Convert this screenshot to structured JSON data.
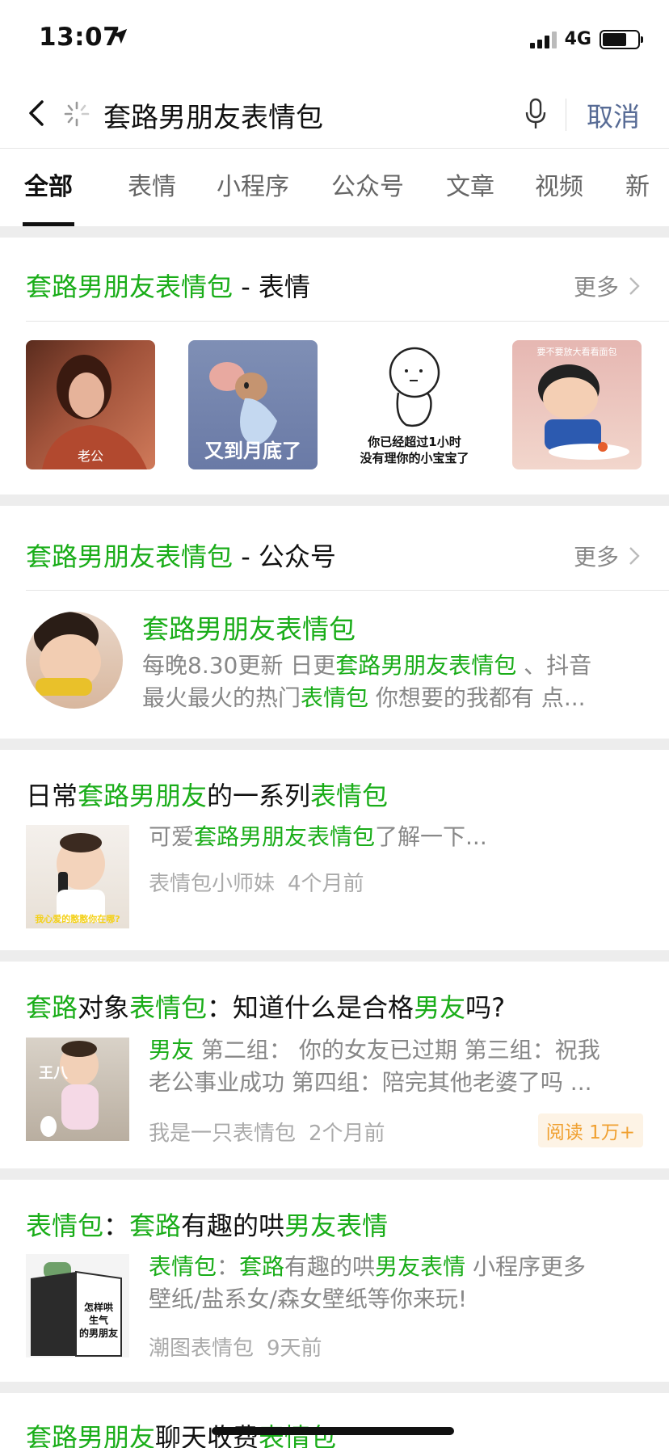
{
  "status": {
    "time": "13:07",
    "network": "4G"
  },
  "search": {
    "query": "套路男朋友表情包",
    "cancel": "取消"
  },
  "tabs": [
    "全部",
    "表情",
    "小程序",
    "公众号",
    "文章",
    "视频",
    "新"
  ],
  "stickers_section": {
    "keyword": "套路男朋友表情包",
    "sep": " - 表情",
    "more": "更多",
    "items": [
      {
        "caption": "老公"
      },
      {
        "caption": "又到月底了"
      },
      {
        "caption_line1": "你已经超过1小时",
        "caption_line2": "没有理你的小宝宝了"
      },
      {
        "caption": "要不要放大看看面包"
      }
    ]
  },
  "account_section": {
    "keyword": "套路男朋友表情包",
    "sep": " - 公众号",
    "more": "更多",
    "name": "套路男朋友表情包",
    "desc_a": "每晚8.30更新 日更",
    "desc_b": "套路男朋友表情包",
    "desc_c": " 、抖音",
    "desc_d": "最火最火的热门",
    "desc_e": "表情包",
    "desc_f": " 你想要的我都有 点..."
  },
  "articles": [
    {
      "t1": "日常",
      "t2": "套路男朋友",
      "t3": "的一系列",
      "t4": "表情包",
      "d1": "可爱",
      "d2": "套路男朋友表情包",
      "d3": "了解一下...",
      "source": "表情包小师妹",
      "time": "4个月前",
      "thumb_caption": "我心爱的憨憨你在哪?"
    },
    {
      "t1": "套路",
      "t2": "对象",
      "t3": "表情包",
      "t4": "：知道什么是合格",
      "t5": "男友",
      "t6": "吗?",
      "d1": "男友",
      "d2": " 第二组： 你的女友已过期 第三组：祝我",
      "d3": "老公事业成功 第四组：陪完其他老婆了吗 ...",
      "source": "我是一只表情包",
      "time": "2个月前",
      "badge": "阅读 1万+",
      "thumb_caption": "王八"
    },
    {
      "t1": "表情包",
      "t2": "：",
      "t3": "套路",
      "t4": "有趣的哄",
      "t5": "男友表情",
      "d1": "表情包",
      "d2": "：",
      "d3": "套路",
      "d4": "有趣的哄",
      "d5": "男友表情",
      "d6": " 小程序更多",
      "d7": "壁纸/盐系女/森女壁纸等你来玩!",
      "source": "潮图表情包",
      "time": "9天前",
      "thumb_caption_1": "怎样哄",
      "thumb_caption_2": "生气",
      "thumb_caption_3": "的男朋友"
    },
    {
      "t1": "套路男朋友",
      "t2": "聊天收费",
      "t3": "表情包"
    }
  ],
  "colors": {
    "accent": "#1aad19",
    "link_blue": "#576b95",
    "badge_orange": "#f0a030"
  }
}
